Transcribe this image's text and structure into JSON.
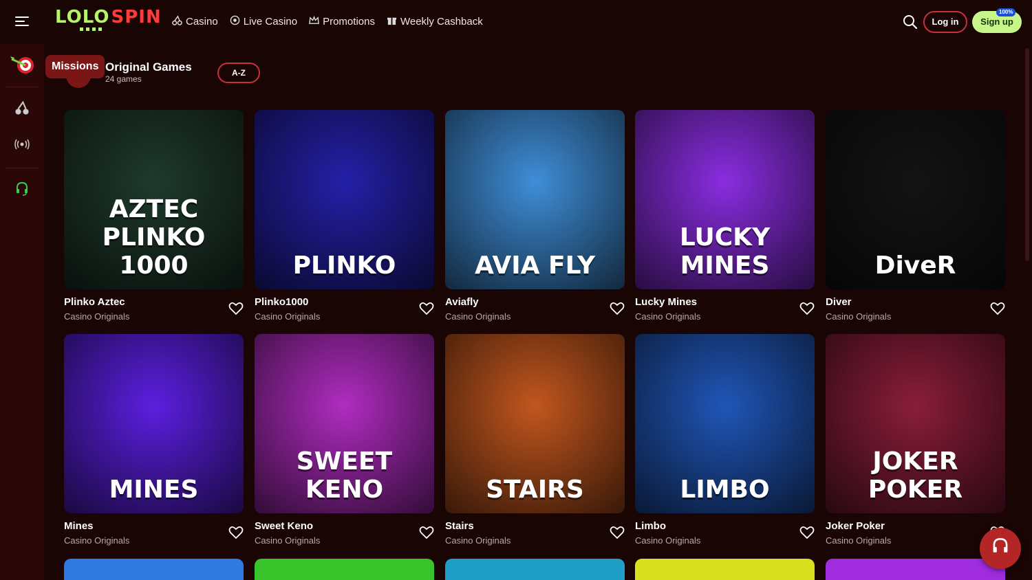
{
  "header": {
    "logo_left": "LOLO",
    "logo_right": "SPIN",
    "nav": [
      {
        "label": "Casino",
        "icon": "cherry-icon"
      },
      {
        "label": "Live Casino",
        "icon": "live-icon"
      },
      {
        "label": "Promotions",
        "icon": "crown-icon"
      },
      {
        "label": "Weekly Cashback",
        "icon": "gift-icon"
      }
    ],
    "login_label": "Log in",
    "signup_label": "Sign up",
    "signup_badge": "100%"
  },
  "sidebar": {
    "missions_tooltip": "Missions",
    "items": [
      "dart-target-icon",
      "cherry-icon",
      "live-broadcast-icon",
      "headset-icon"
    ]
  },
  "section": {
    "title": "Original Games",
    "count": "24 games",
    "sort_label": "A-Z"
  },
  "games": [
    {
      "name": "Plinko Aztec",
      "provider": "Casino Originals",
      "art": "AZTEC PLINKO 1000",
      "bg": "#1f3a2c"
    },
    {
      "name": "Plinko1000",
      "provider": "Casino Originals",
      "art": "PLINKO",
      "bg": "#2420a8"
    },
    {
      "name": "Aviafly",
      "provider": "Casino Originals",
      "art": "AVIA FLY",
      "bg": "#3f8ed8"
    },
    {
      "name": "Lucky Mines",
      "provider": "Casino Originals",
      "art": "LUCKY MINES",
      "bg": "#8a2de0"
    },
    {
      "name": "Diver",
      "provider": "Casino Originals",
      "art": "DiveR",
      "bg": "#141414"
    },
    {
      "name": "Mines",
      "provider": "Casino Originals",
      "art": "MINES",
      "bg": "#5b1fe0"
    },
    {
      "name": "Sweet Keno",
      "provider": "Casino Originals",
      "art": "SWEET KENO",
      "bg": "#b02cc0"
    },
    {
      "name": "Stairs",
      "provider": "Casino Originals",
      "art": "STAIRS",
      "bg": "#c2561e"
    },
    {
      "name": "Limbo",
      "provider": "Casino Originals",
      "art": "LIMBO",
      "bg": "#2056b8"
    },
    {
      "name": "Joker Poker",
      "provider": "Casino Originals",
      "art": "JOKER POKER",
      "bg": "#8a1d3a"
    }
  ],
  "partial_row_colors": [
    "#2f7ae0",
    "#38c42a",
    "#1f9fc8",
    "#d8e020",
    "#a02ce0"
  ],
  "colors": {
    "accent_red": "#c8313a",
    "accent_green": "#c7f58a",
    "bg": "#1a0505"
  }
}
